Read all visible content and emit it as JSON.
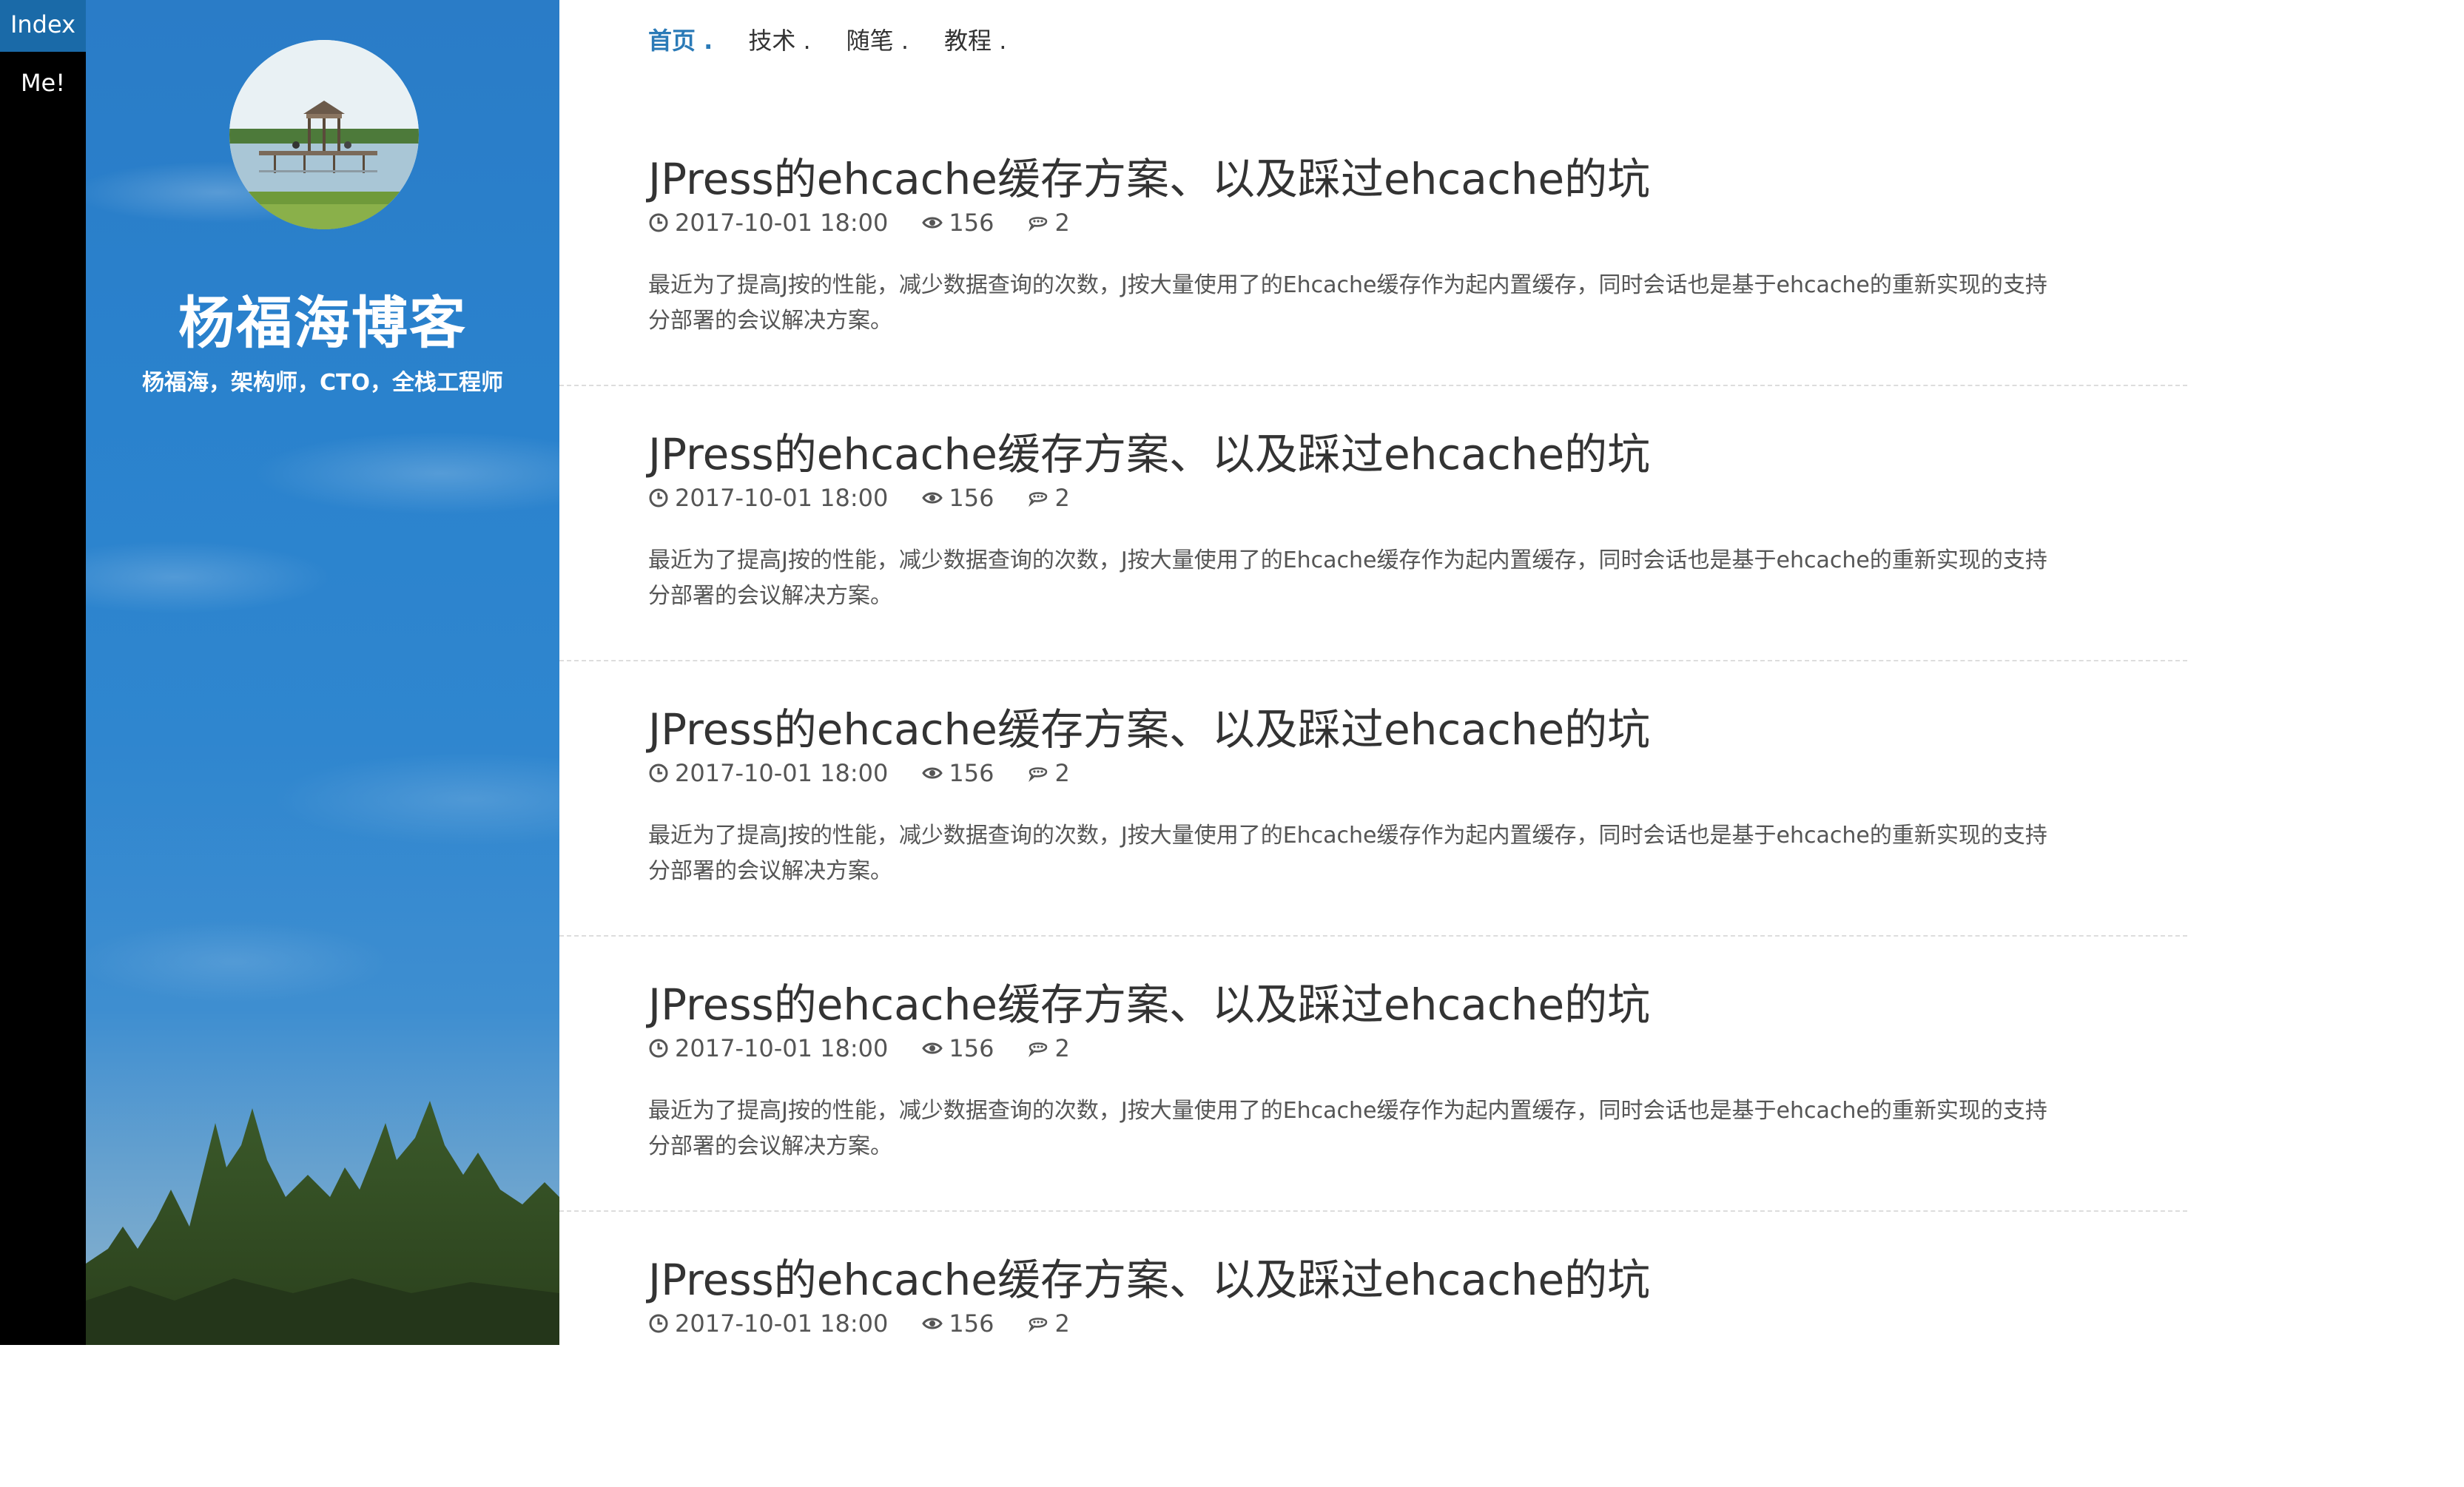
{
  "leftbar": {
    "index_label": "Index",
    "me_label": "Me!"
  },
  "sidebar": {
    "blog_title": "杨福海博客",
    "blog_subtitle": "杨福海，架构师，CTO，全栈工程师"
  },
  "nav": [
    {
      "label": "首页 .",
      "active": true
    },
    {
      "label": "技术 .",
      "active": false
    },
    {
      "label": "随笔 .",
      "active": false
    },
    {
      "label": "教程 .",
      "active": false
    }
  ],
  "posts": [
    {
      "title": "JPress的ehcache缓存方案、以及踩过ehcache的坑",
      "date": "2017-10-01 18:00",
      "views": "156",
      "comments": "2",
      "excerpt": "最近为了提高J按的性能，减少数据查询的次数，J按大量使用了的Ehcache缓存作为起内置缓存，同时会话也是基于ehcache的重新实现的支持分部署的会议解决方案。"
    },
    {
      "title": "JPress的ehcache缓存方案、以及踩过ehcache的坑",
      "date": "2017-10-01 18:00",
      "views": "156",
      "comments": "2",
      "excerpt": "最近为了提高J按的性能，减少数据查询的次数，J按大量使用了的Ehcache缓存作为起内置缓存，同时会话也是基于ehcache的重新实现的支持分部署的会议解决方案。"
    },
    {
      "title": "JPress的ehcache缓存方案、以及踩过ehcache的坑",
      "date": "2017-10-01 18:00",
      "views": "156",
      "comments": "2",
      "excerpt": "最近为了提高J按的性能，减少数据查询的次数，J按大量使用了的Ehcache缓存作为起内置缓存，同时会话也是基于ehcache的重新实现的支持分部署的会议解决方案。"
    },
    {
      "title": "JPress的ehcache缓存方案、以及踩过ehcache的坑",
      "date": "2017-10-01 18:00",
      "views": "156",
      "comments": "2",
      "excerpt": "最近为了提高J按的性能，减少数据查询的次数，J按大量使用了的Ehcache缓存作为起内置缓存，同时会话也是基于ehcache的重新实现的支持分部署的会议解决方案。"
    },
    {
      "title": "JPress的ehcache缓存方案、以及踩过ehcache的坑",
      "date": "2017-10-01 18:00",
      "views": "156",
      "comments": "2",
      "excerpt": ""
    }
  ],
  "colors": {
    "accent": "#2a7ab7",
    "sidebar_sky": "#2a7cc7",
    "leftbar": "#000000"
  }
}
